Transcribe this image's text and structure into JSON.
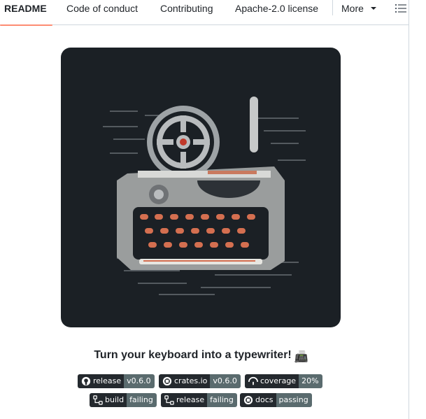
{
  "tabs": [
    {
      "label": "README",
      "active": true
    },
    {
      "label": "Code of conduct"
    },
    {
      "label": "Contributing"
    },
    {
      "label": "Apache-2.0 license"
    },
    {
      "label": "More"
    }
  ],
  "icons": {
    "outline": "list-outline-icon",
    "more_caret": "chevron-down-icon"
  },
  "hero": {
    "description_icon": "typewriter-image"
  },
  "tagline": {
    "text": "Turn your keyboard into a typewriter!",
    "emoji": "📠"
  },
  "badges": [
    {
      "label": "release",
      "value": "v0.6.0",
      "icon": "github-icon"
    },
    {
      "label": "crates.io",
      "value": "v0.6.0",
      "icon": "rust-icon"
    },
    {
      "label": "coverage",
      "value": "20%",
      "icon": "codecov-umbrella-icon"
    },
    {
      "label": "build",
      "value": "failing",
      "icon": "workflow-icon"
    },
    {
      "label": "release",
      "value": "failing",
      "icon": "workflow-icon"
    },
    {
      "label": "docs",
      "value": "passing",
      "icon": "docs-rs-icon"
    }
  ],
  "colors": {
    "tab_underline": "#fd8c73",
    "badge_left": "#24292e",
    "badge_right": "#5a6b6e",
    "hero_bg": "#1b2025"
  }
}
